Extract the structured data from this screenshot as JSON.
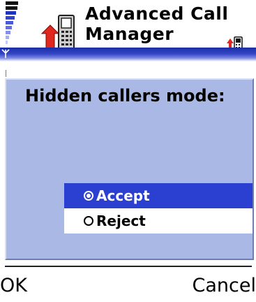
{
  "header": {
    "title_line1": "Advanced Call",
    "title_line2": "Manager",
    "signal_icon": "signal-strength-icon",
    "app_icon": "call-manager-icon",
    "mini_icon": "phone-forward-icon",
    "antenna_icon": "antenna-icon"
  },
  "dialog": {
    "title": "Hidden callers mode:",
    "options": [
      {
        "label": "Accept",
        "selected": true
      },
      {
        "label": "Reject",
        "selected": false
      }
    ]
  },
  "softkeys": {
    "left": "OK",
    "right": "Cancel"
  },
  "colors": {
    "header_bar": "#1b2ea6",
    "dialog_bg": "#aab8e6",
    "selection": "#2b3fd1"
  }
}
